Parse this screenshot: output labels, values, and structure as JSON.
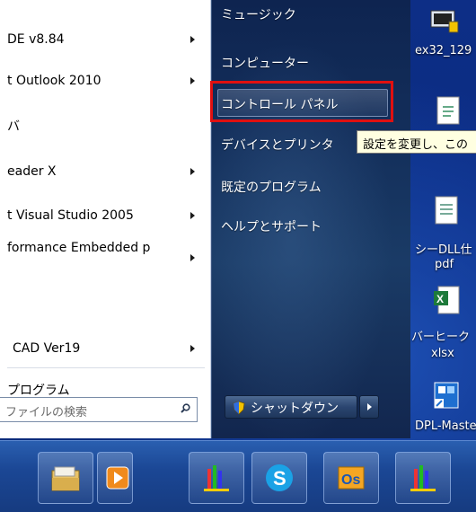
{
  "start_menu": {
    "programs": [
      {
        "label": "DE v8.84",
        "has_submenu": true
      },
      {
        "label": "t Outlook 2010",
        "has_submenu": true
      },
      {
        "label": "バ",
        "has_submenu": false
      },
      {
        "label": "eader X",
        "has_submenu": true
      },
      {
        "label": "t Visual Studio 2005",
        "has_submenu": true
      },
      {
        "label": "formance Embedded p",
        "has_submenu": true
      },
      {
        "label": "CAD Ver19",
        "has_submenu": true
      }
    ],
    "all_programs": "プログラム",
    "search": {
      "placeholder": "ファイルの検索"
    },
    "right_items": [
      {
        "label": "ミュージック"
      },
      {
        "label": "コンピューター"
      },
      {
        "label": "コントロール パネル"
      },
      {
        "label": "デバイスとプリンタ"
      },
      {
        "label": "既定のプログラム"
      },
      {
        "label": "ヘルプとサポート"
      }
    ],
    "shutdown_label": "シャットダウン"
  },
  "tooltip": {
    "text": "設定を変更し、この"
  },
  "desktop_icons": [
    {
      "label": "ex32_129"
    },
    {
      "label": "シーDLL仕"
    },
    {
      "label": "pdf"
    },
    {
      "label": "バーヒーク"
    },
    {
      "label": "xlsx"
    },
    {
      "label": "DPL-Maste"
    }
  ],
  "taskbar": {
    "items": [
      {
        "icon": "explorer-icon"
      },
      {
        "icon": "media-player-icon"
      },
      {
        "icon": "app-bars-icon"
      },
      {
        "icon": "skype-icon"
      },
      {
        "icon": "outlook-icon"
      },
      {
        "icon": "app-bars-icon-2"
      }
    ]
  },
  "colors": {
    "highlight_border": "#e01010",
    "tooltip_bg": "#ffffe1"
  }
}
